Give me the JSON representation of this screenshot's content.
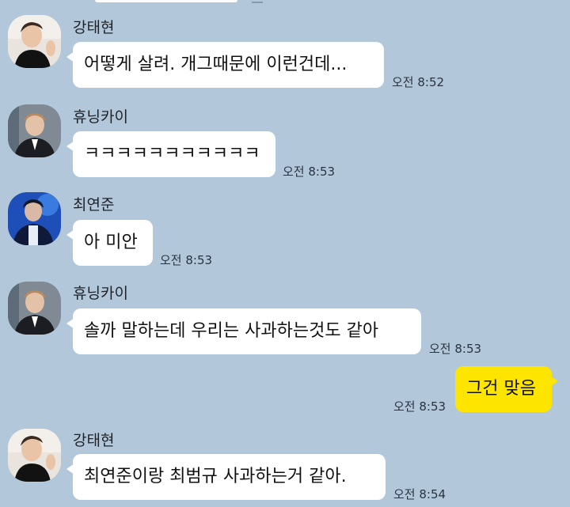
{
  "messages": [
    {
      "sender": "강태현",
      "text": "어떻게 살려. 개그때문에 이런건데...",
      "time": "오전 8:52"
    },
    {
      "sender": "휴닝카이",
      "text": "ㅋㅋㅋㅋㅋㅋㅋㅋㅋㅋㅋ",
      "time": "오전 8:53"
    },
    {
      "sender": "최연준",
      "text": "아 미안",
      "time": "오전 8:53"
    },
    {
      "sender": "휴닝카이",
      "text": "솔까 말하는데 우리는 사과하는것도 같아",
      "time": "오전 8:53"
    },
    {
      "text": "그건 맞음",
      "time": "오전 8:53"
    },
    {
      "sender": "강태현",
      "text": "최연준이랑 최범규 사과하는거 같아.",
      "time": "오전 8:54"
    }
  ],
  "colors": {
    "background": "#b2c7da",
    "incoming_bubble": "#ffffff",
    "outgoing_bubble": "#fee500"
  }
}
